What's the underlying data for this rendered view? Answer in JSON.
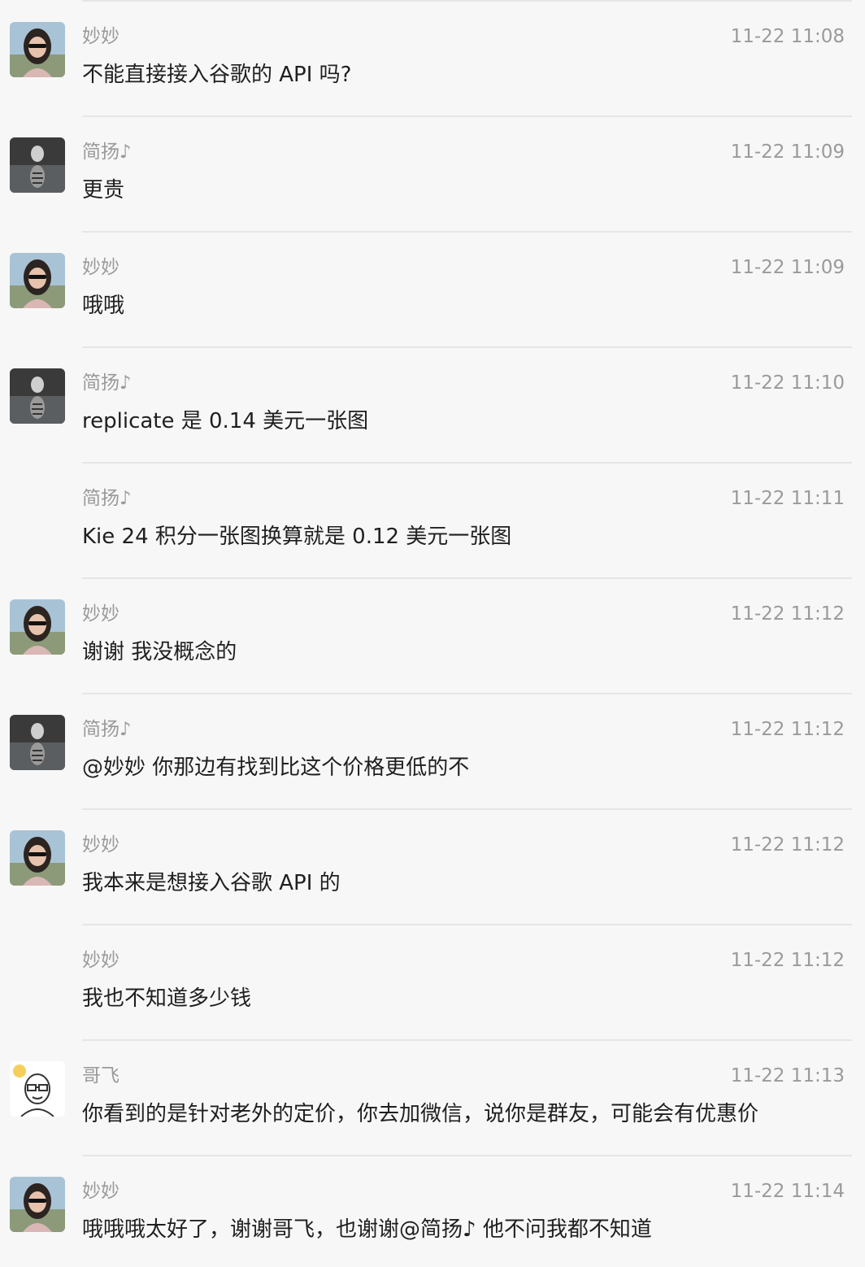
{
  "messages": [
    {
      "sender": "妙妙",
      "time": "11-22 11:08",
      "text": "不能直接接入谷歌的 API 吗?",
      "avatar": "woman-sunglasses-avatar"
    },
    {
      "sender": "简扬♪",
      "time": "11-22 11:09",
      "text": "更贵",
      "avatar": "tiger-cat-avatar"
    },
    {
      "sender": "妙妙",
      "time": "11-22 11:09",
      "text": "哦哦",
      "avatar": "woman-sunglasses-avatar"
    },
    {
      "sender": "简扬♪",
      "time": "11-22 11:10",
      "text": "replicate 是 0.14 美元一张图",
      "avatar": "tiger-cat-avatar"
    },
    {
      "sender": "简扬♪",
      "time": "11-22 11:11",
      "text": "Kie 24 积分一张图换算就是 0.12 美元一张图",
      "avatar": null
    },
    {
      "sender": "妙妙",
      "time": "11-22 11:12",
      "text": "谢谢 我没概念的",
      "avatar": "woman-sunglasses-avatar"
    },
    {
      "sender": "简扬♪",
      "time": "11-22 11:12",
      "text": "@妙妙 你那边有找到比这个价格更低的不",
      "avatar": "tiger-cat-avatar"
    },
    {
      "sender": "妙妙",
      "time": "11-22 11:12",
      "text": "我本来是想接入谷歌 API 的",
      "avatar": "woman-sunglasses-avatar"
    },
    {
      "sender": "妙妙",
      "time": "11-22 11:12",
      "text": "我也不知道多少钱",
      "avatar": null
    },
    {
      "sender": "哥飞",
      "time": "11-22 11:13",
      "text": "你看到的是针对老外的定价，你去加微信，说你是群友，可能会有优惠价",
      "avatar": "cartoon-glasses-avatar"
    },
    {
      "sender": "妙妙",
      "time": "11-22 11:14",
      "text": "哦哦哦太好了，谢谢哥飞，也谢谢@简扬♪ 他不问我都不知道",
      "avatar": "woman-sunglasses-avatar"
    }
  ],
  "colors": {
    "background": "#f7f7f7",
    "divider": "#e6e6e6",
    "meta_text": "#9a9a9a",
    "body_text": "#1f1f1f"
  }
}
